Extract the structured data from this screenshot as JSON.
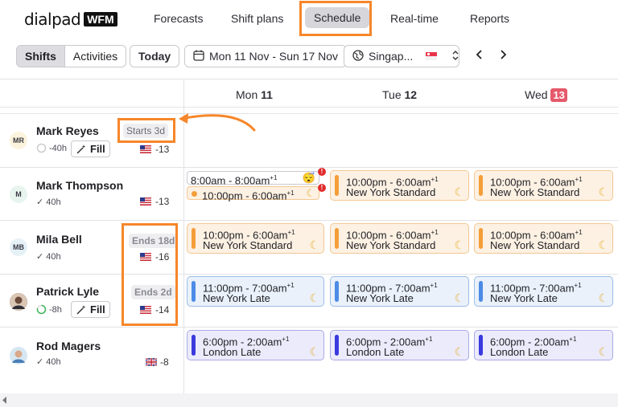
{
  "app": {
    "logo_text": "dialpad",
    "logo_badge": "WFM"
  },
  "nav": {
    "tabs": [
      "Forecasts",
      "Shift plans",
      "Schedule",
      "Real-time",
      "Reports"
    ],
    "active": "Schedule"
  },
  "toolbar": {
    "view_shifts": "Shifts",
    "view_activities": "Activities",
    "today": "Today",
    "date_range": "Mon 11 Nov - Sun 17 Nov",
    "timezone": "Singap...",
    "prev": "‹",
    "next": "›"
  },
  "days": [
    {
      "dow": "Mon",
      "num": "11",
      "today": false
    },
    {
      "dow": "Tue",
      "num": "12",
      "today": false
    },
    {
      "dow": "Wed",
      "num": "13",
      "today": true
    }
  ],
  "people": [
    {
      "initials": "MR",
      "name": "Mark Reyes",
      "hours": "-40h",
      "fill": "Fill",
      "tz": "-13",
      "flag": "us",
      "tag": "Starts 3d"
    },
    {
      "initials": "M",
      "name": "Mark Thompson",
      "hours": "40h",
      "tz": "-13",
      "flag": "us"
    },
    {
      "initials": "MB",
      "name": "Mila Bell",
      "hours": "40h",
      "tz": "-16",
      "flag": "us",
      "tag": "Ends 18d"
    },
    {
      "initials": "",
      "name": "Patrick Lyle",
      "hours": "-8h",
      "fill": "Fill",
      "tz": "-14",
      "flag": "us",
      "tag": "Ends 2d"
    },
    {
      "initials": "",
      "name": "Rod Magers",
      "hours": "40h",
      "tz": "-8",
      "flag": "uk"
    }
  ],
  "shifts": {
    "mt_mon_a": "8:00am - 8:00am",
    "mt_mon_b": "10:00pm - 6:00am",
    "ny_time": "10:00pm - 6:00am",
    "ny_label": "New York Standard",
    "nyl_time": "11:00pm - 7:00am",
    "nyl_label": "New York Late",
    "ldn_time": "6:00pm - 2:00am",
    "ldn_label": "London Late",
    "plus1": "+1"
  },
  "colors": {
    "accent": "#f7862a",
    "orange": "#f49e3a",
    "blue": "#4c8be6",
    "indigo": "#3a3adf",
    "today": "#e5596a"
  }
}
